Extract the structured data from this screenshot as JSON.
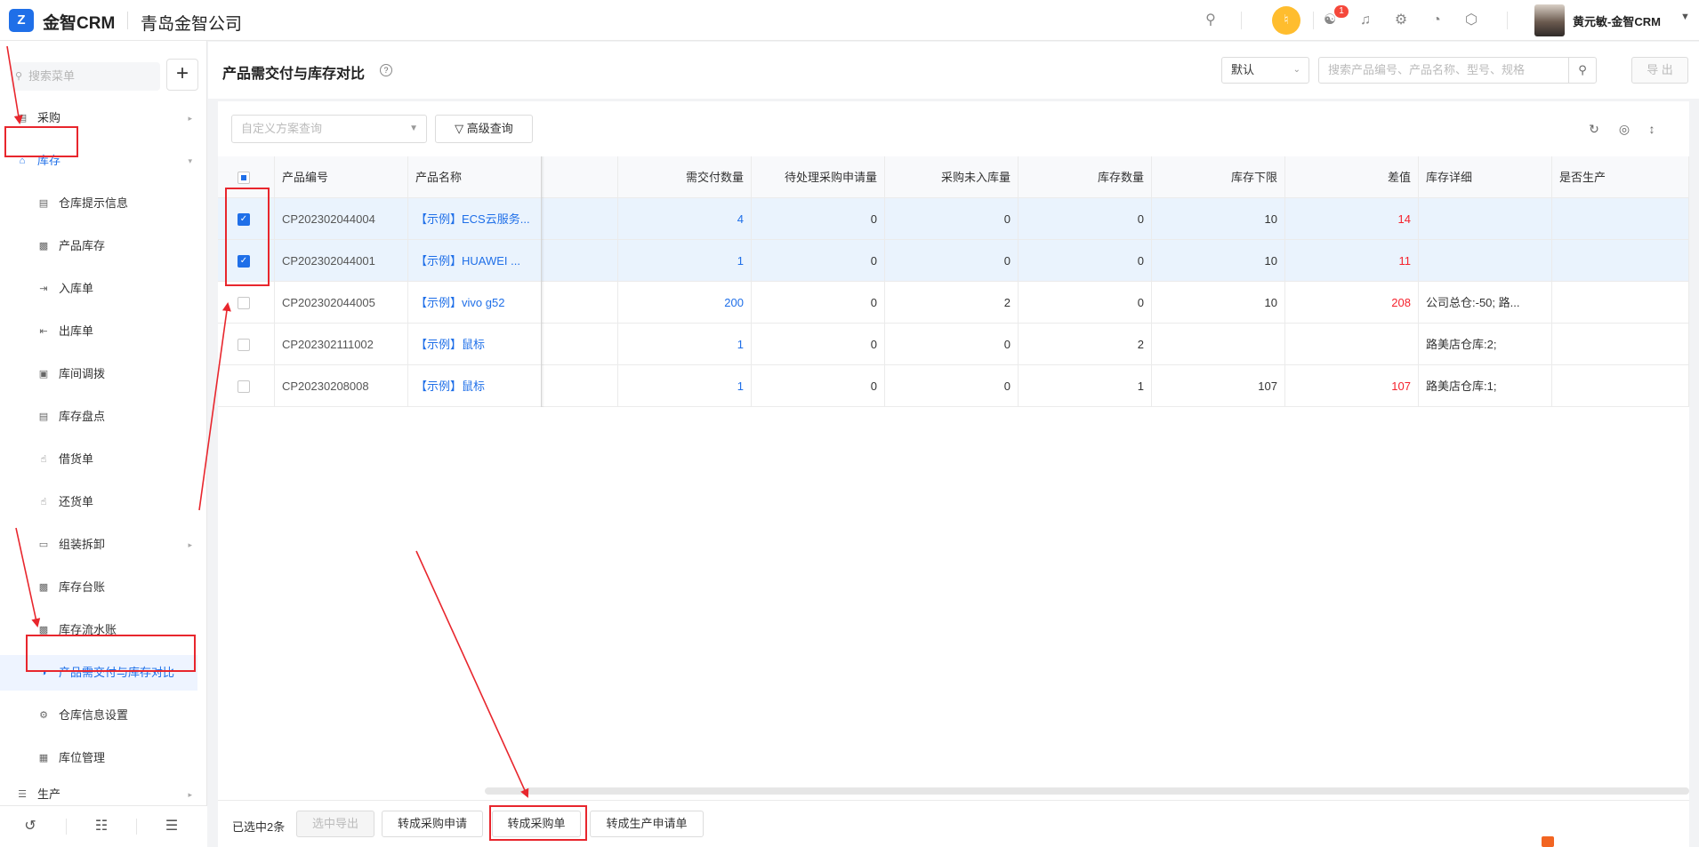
{
  "app": {
    "logo_glyph": "Z",
    "logo_text": "金智CRM",
    "company": "青岛金智公司",
    "brand_color": "#1f6fe8"
  },
  "topbar": {
    "icons": [
      "search-icon",
      "speaker-icon",
      "contacts-icon",
      "bell-icon",
      "gear-icon",
      "pie-chart-icon",
      "cube-icon"
    ],
    "notification_count": "1",
    "user_name": "黄元敏-金智CRM"
  },
  "sidebar": {
    "search_placeholder": "搜索菜单",
    "add_label": "+",
    "items": [
      {
        "label": "采购",
        "icon": "cart-icon",
        "level": "top",
        "arrow": "▸"
      },
      {
        "label": "库存",
        "icon": "home-icon",
        "level": "top",
        "arrow": "▾",
        "state": "open"
      },
      {
        "label": "仓库提示信息",
        "icon": "list-icon",
        "level": "sub"
      },
      {
        "label": "产品库存",
        "icon": "doc-icon",
        "level": "sub"
      },
      {
        "label": "入库单",
        "icon": "inbound-icon",
        "level": "sub"
      },
      {
        "label": "出库单",
        "icon": "outbound-icon",
        "level": "sub"
      },
      {
        "label": "库间调拨",
        "icon": "transfer-icon",
        "level": "sub"
      },
      {
        "label": "库存盘点",
        "icon": "clipboard-icon",
        "level": "sub"
      },
      {
        "label": "借货单",
        "icon": "hand-icon",
        "level": "sub"
      },
      {
        "label": "还货单",
        "icon": "hand-icon",
        "level": "sub"
      },
      {
        "label": "组装拆卸",
        "icon": "folder-icon",
        "level": "sub",
        "arrow": "▸"
      },
      {
        "label": "库存台账",
        "icon": "ledger-icon",
        "level": "sub"
      },
      {
        "label": "库存流水账",
        "icon": "ledger-icon",
        "level": "sub"
      },
      {
        "label": "产品需交付与库存对比",
        "icon": "half-circle-icon",
        "level": "sub",
        "state": "active"
      },
      {
        "label": "仓库信息设置",
        "icon": "settings-icon",
        "level": "sub"
      },
      {
        "label": "库位管理",
        "icon": "grid-icon",
        "level": "sub"
      },
      {
        "label": "生产",
        "icon": "factory-icon",
        "level": "top",
        "arrow": "▸"
      }
    ],
    "footer_icons": [
      "history-icon",
      "sliders-icon",
      "collapse-menu-icon"
    ]
  },
  "header": {
    "title": "产品需交付与库存对比",
    "view_select": "默认",
    "search_placeholder": "搜索产品编号、产品名称、型号、规格",
    "export_label": "导 出"
  },
  "toolbar": {
    "plan_placeholder": "自定义方案查询",
    "advanced_query": "高级查询",
    "icons": [
      "refresh-icon",
      "settings-icon",
      "column-sort-icon"
    ]
  },
  "table": {
    "columns": [
      "产品编号",
      "产品名称",
      "",
      "需交付数量",
      "待处理采购申请量",
      "采购未入库量",
      "库存数量",
      "库存下限",
      "差值",
      "库存详细",
      "是否生产"
    ],
    "rows": [
      {
        "checked": true,
        "code": "CP202302044004",
        "name": "【示例】ECS云服务...",
        "demand": "4",
        "pending_request": "0",
        "not_in_stock": "0",
        "stock": "0",
        "lower_limit": "10",
        "diff": "14",
        "detail": "",
        "produce": ""
      },
      {
        "checked": true,
        "code": "CP202302044001",
        "name": "【示例】HUAWEI ...",
        "demand": "1",
        "pending_request": "0",
        "not_in_stock": "0",
        "stock": "0",
        "lower_limit": "10",
        "diff": "11",
        "detail": "",
        "produce": ""
      },
      {
        "checked": false,
        "code": "CP202302044005",
        "name": "【示例】vivo g52",
        "demand": "200",
        "pending_request": "0",
        "not_in_stock": "2",
        "stock": "0",
        "lower_limit": "10",
        "diff": "208",
        "detail": "公司总仓:-50;    路...",
        "produce": ""
      },
      {
        "checked": false,
        "code": "CP202302111002",
        "name": "【示例】鼠标",
        "demand": "1",
        "pending_request": "0",
        "not_in_stock": "0",
        "stock": "2",
        "lower_limit": "",
        "diff": "",
        "detail": "路美店仓库:2;",
        "produce": ""
      },
      {
        "checked": false,
        "code": "CP20230208008",
        "name": "【示例】鼠标",
        "demand": "1",
        "pending_request": "0",
        "not_in_stock": "0",
        "stock": "1",
        "lower_limit": "107",
        "diff": "107",
        "detail": "路美店仓库:1;",
        "produce": ""
      }
    ]
  },
  "bottom": {
    "selected_text": "已选中2条",
    "buttons": [
      "选中导出",
      "转成采购申请",
      "转成采购单",
      "转成生产申请单"
    ]
  },
  "annotation_color": "#e8262d"
}
